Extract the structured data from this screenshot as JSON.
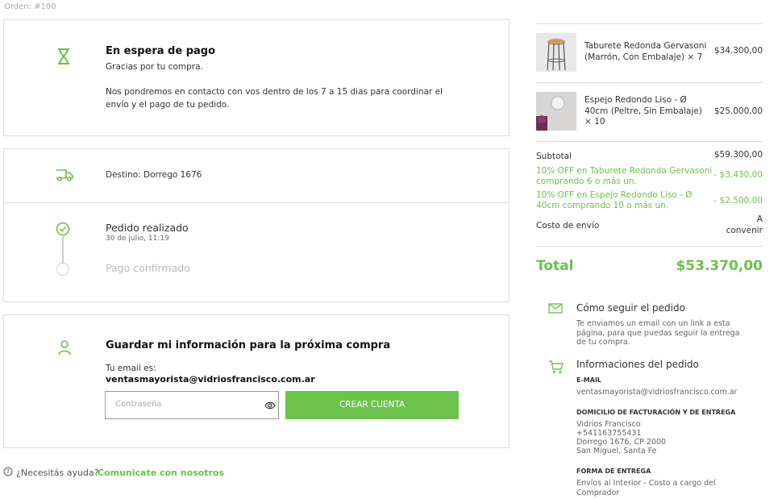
{
  "order": {
    "label": "Orden: #100"
  },
  "payment": {
    "title": "En espera de pago",
    "subtitle": "Gracias por tu compra.",
    "message": "Nos pondremos en contacto con vos dentro de los 7 a 15  dias para coordinar el envío y el pago de tu pedido."
  },
  "shipping": {
    "destination": "Destino: Dorrego 1676"
  },
  "timeline": {
    "step1_title": "Pedido realizado",
    "step1_date": "30 de julio, 11:19",
    "step2_title": "Pago confirmado"
  },
  "account": {
    "title": "Guardar mi información para la próxima compra",
    "email_label": "Tu email es:",
    "email": "ventasmayorista@vidriosfrancisco.com.ar",
    "password_placeholder": "Contraseña",
    "create_button": "CREAR CUENTA"
  },
  "help": {
    "text": "¿Necesitás ayuda?",
    "link": "Comunicate con nosotros"
  },
  "cart": {
    "items": [
      {
        "name": "Taburete Redonda Gervasoni (Marrón, Con Embalaje) × 7",
        "price": "$34.300,00"
      },
      {
        "name": "Espejo Redondo Liso - Ø 40cm (Peltre, Sin Embalaje) × 10",
        "price": "$25.000,00"
      }
    ],
    "subtotal_label": "Subtotal",
    "subtotal_value": "$59.300,00",
    "discounts": [
      {
        "label": "10% OFF en Taburete Redonda Gervasoni comprando 6 o más un.",
        "value": "- $3.430,00"
      },
      {
        "label": "10% OFF en Espejo Redondo Liso - Ø 40cm comprando 10 o más un.",
        "value": "- $2.500,00"
      }
    ],
    "shipping_label": "Costo de envío",
    "shipping_value": "A convenir",
    "total_label": "Total",
    "total_value": "$53.370,00"
  },
  "tracking": {
    "title": "Cómo seguir el pedido",
    "text": "Te enviamos un email con un link a esta página, para que puedas seguir la entrega de tu compra."
  },
  "info": {
    "title": "Informaciones del pedido",
    "email_heading": "E-MAIL",
    "email_value": "ventasmayorista@vidriosfrancisco.com.ar",
    "address_heading": "DOMICILIO DE FACTURACIÓN Y DE ENTREGA",
    "address_lines": [
      "Vidrios Francisco",
      "+541163755431",
      "Dorrego 1676, CP 2000",
      "San Miguel, Santa Fe"
    ],
    "delivery_heading": "FORMA DE ENTREGA",
    "delivery_value": "Envíos al Interior - Costo a cargo del Comprador"
  },
  "colors": {
    "accent": "#6cc24a",
    "border": "#dddddd"
  }
}
